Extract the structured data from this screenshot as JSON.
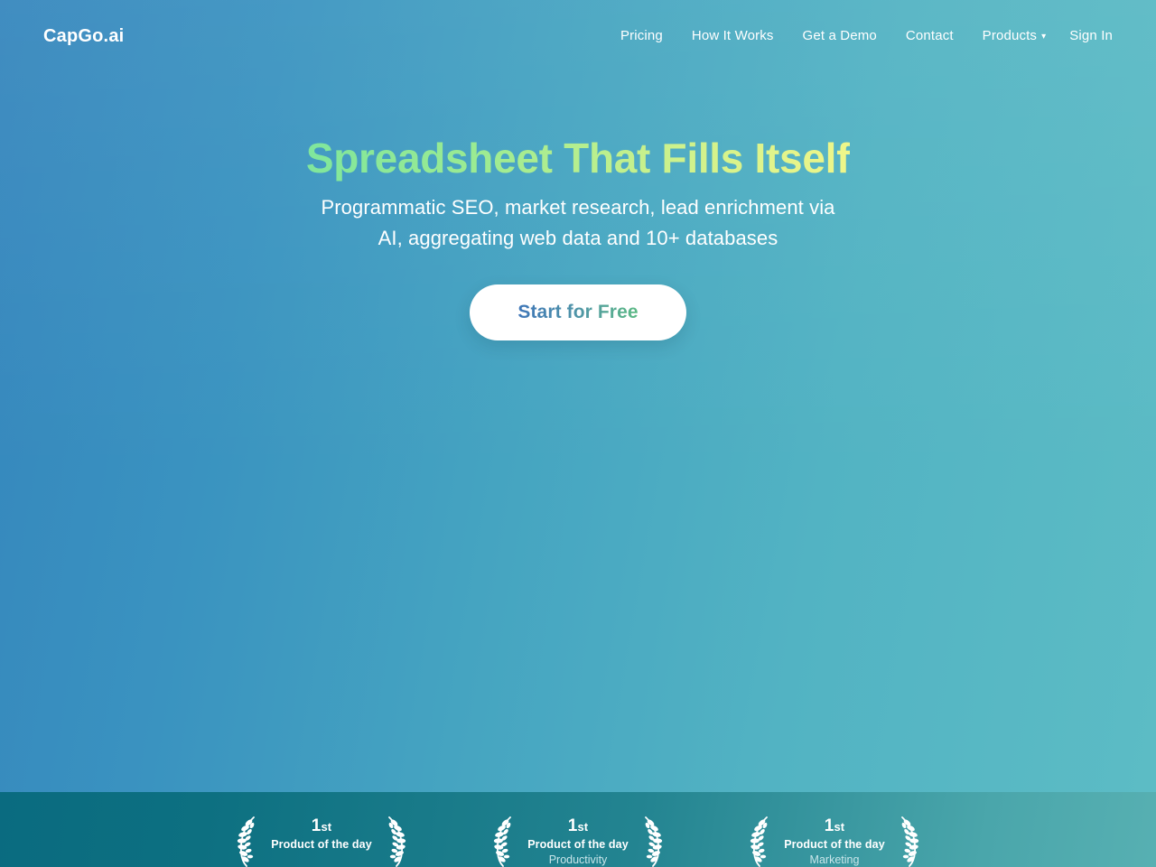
{
  "brand": {
    "name": "CapGo.ai"
  },
  "nav": {
    "items": [
      {
        "label": "Pricing",
        "icon": null
      },
      {
        "label": "How It Works",
        "icon": null
      },
      {
        "label": "Get a Demo",
        "icon": null
      },
      {
        "label": "Contact",
        "icon": null
      },
      {
        "label": "Products",
        "icon": "chevron-down-icon",
        "caret": "▾"
      },
      {
        "label": "Sign In",
        "icon": null
      }
    ]
  },
  "hero": {
    "headline": "Spreadsheet That Fills Itself",
    "subheadline_line1": "Programmatic SEO, market research, lead enrichment via",
    "subheadline_line2": "AI, aggregating web data and 10+ databases",
    "cta_label": "Start for Free"
  },
  "badges": {
    "items": [
      {
        "rank": "1",
        "rank_suffix": "st",
        "title": "Product of the day",
        "category": ""
      },
      {
        "rank": "1",
        "rank_suffix": "st",
        "title": "Product of the day",
        "category": "Productivity"
      },
      {
        "rank": "1",
        "rank_suffix": "st",
        "title": "Product of the day",
        "category": "Marketing"
      }
    ]
  },
  "colors": {
    "bg_start": "#3586bd",
    "bg_end": "#5cbcc5",
    "band_start": "#0a6b80",
    "band_end": "#57b0b2",
    "headline_gradient_start": "#7fe69c",
    "headline_gradient_end": "#f0f68a",
    "cta_text_start": "#3f76b8",
    "cta_text_end": "#5cba84",
    "cta_bg": "#ffffff",
    "nav_text": "#ffffff"
  }
}
